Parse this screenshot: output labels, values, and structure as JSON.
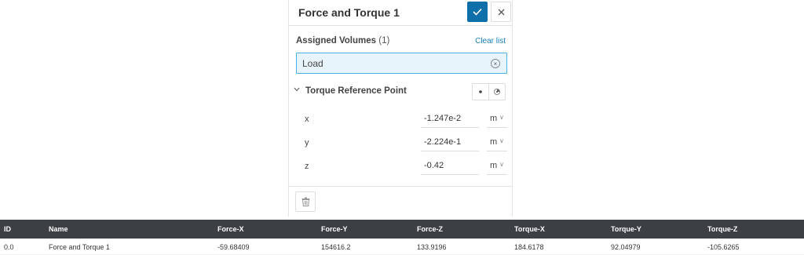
{
  "panel": {
    "title": "Force and Torque 1",
    "assigned_volumes_label": "Assigned Volumes",
    "assigned_volumes_count": "(1)",
    "clear_list_label": "Clear list",
    "assigned_items": [
      "Load"
    ],
    "torque_section_title": "Torque Reference Point",
    "coordinates": [
      {
        "label": "x",
        "value": "-1.247e-2",
        "unit": "m"
      },
      {
        "label": "y",
        "value": "-2.224e-1",
        "unit": "m"
      },
      {
        "label": "z",
        "value": "-0.42",
        "unit": "m"
      }
    ],
    "accent_color": "#0f6fa8",
    "field_highlight_color": "#4bb0e6"
  },
  "results_table": {
    "columns": [
      "ID",
      "Name",
      "Force-X",
      "Force-Y",
      "Force-Z",
      "Torque-X",
      "Torque-Y",
      "Torque-Z"
    ],
    "rows": [
      [
        "0.0",
        "Force and Torque 1",
        "-59.68409",
        "154616.2",
        "133.9196",
        "184.6178",
        "92.04979",
        "-105.6265"
      ]
    ],
    "header_color": "#3c3f44"
  }
}
